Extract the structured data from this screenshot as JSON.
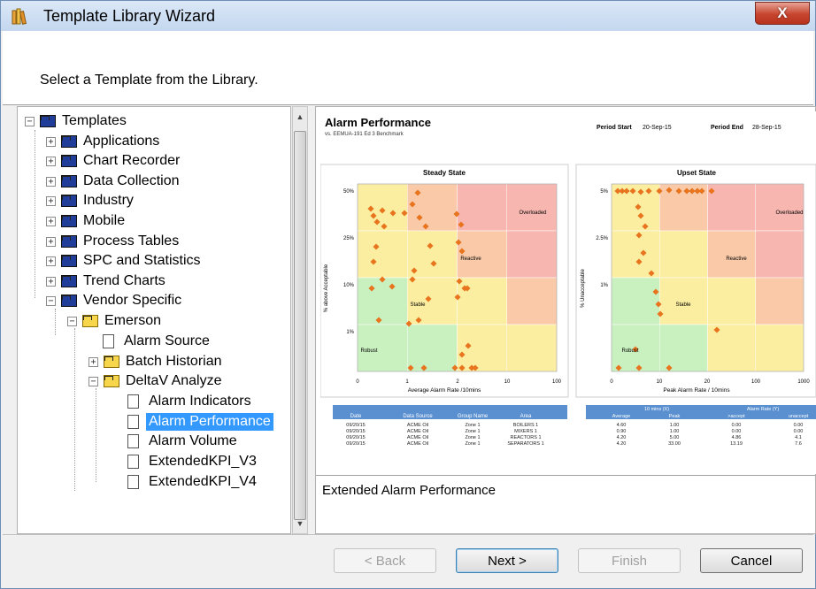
{
  "window": {
    "title": "Template Library Wizard",
    "close_glyph": "X"
  },
  "header": {
    "instruction": "Select a Template from the Library."
  },
  "tree": {
    "root": "Templates",
    "items": [
      "Applications",
      "Chart Recorder",
      "Data Collection",
      "Industry",
      "Mobile",
      "Process Tables",
      "SPC and Statistics",
      "Trend Charts",
      "Vendor Specific"
    ],
    "vendor": "Emerson",
    "emerson_children": {
      "alarm_source": "Alarm Source",
      "batch_historian": "Batch Historian",
      "deltav": "DeltaV Analyze"
    },
    "deltav_children": [
      "Alarm Indicators",
      "Alarm Performance",
      "Alarm Volume",
      "ExtendedKPI_V3",
      "ExtendedKPI_V4"
    ],
    "selected": "Alarm Performance"
  },
  "preview": {
    "title": "Alarm Performance",
    "subtitle": "vs. EEMUA-191 Ed 3 Benchmark",
    "period_start_label": "Period Start",
    "period_start": "20-Sep-15",
    "period_end_label": "Period End",
    "period_end": "28-Sep-15",
    "left_chart": {
      "title": "Steady State",
      "ylabel": "% above Acceptable",
      "xlabel": "Average Alarm Rate /10mins",
      "yticks": [
        "50%",
        "25%",
        "10%",
        "1%"
      ],
      "xticks": [
        "0",
        "1",
        "2",
        "10",
        "100"
      ],
      "zones": [
        "Overloaded",
        "Reactive",
        "Stable",
        "Robust"
      ]
    },
    "right_chart": {
      "title": "Upset State",
      "ylabel": "% Unacceptable",
      "xlabel": "Peak Alarm Rate / 10mins",
      "yticks": [
        "5%",
        "2.5%",
        "1%"
      ],
      "xticks": [
        "0",
        "10",
        "20",
        "100",
        "1000"
      ],
      "zones": [
        "Overloaded",
        "Reactive",
        "Stable",
        "Robust"
      ]
    },
    "left_table": {
      "headers": [
        "Date",
        "Data Source",
        "Group Name",
        "Area"
      ],
      "rows": [
        [
          "09/20/15",
          "ACME Oil",
          "Zone 1",
          "BOILERS 1"
        ],
        [
          "09/20/15",
          "ACME Oil",
          "Zone 1",
          "MIXERS 1"
        ],
        [
          "09/20/15",
          "ACME Oil",
          "Zone 1",
          "REACTORS 1"
        ],
        [
          "09/20/15",
          "ACME Oil",
          "Zone 1",
          "SEPARATORS 1"
        ]
      ]
    },
    "right_table": {
      "group_headers": [
        "10 mins (X)",
        "Alarm Rate (Y)"
      ],
      "headers": [
        "Average",
        "Peak",
        ">accept",
        "unaccept"
      ],
      "rows": [
        [
          "4.60",
          "1.00",
          "0.00",
          "0.00"
        ],
        [
          "0.90",
          "1.00",
          "0.00",
          "0.00"
        ],
        [
          "4.20",
          "5.00",
          "4.86",
          "4.1"
        ],
        [
          "4.20",
          "33.00",
          "13.19",
          "7.6"
        ]
      ]
    },
    "description": "Extended Alarm Performance"
  },
  "buttons": {
    "back": "< Back",
    "next": "Next >",
    "finish": "Finish",
    "cancel": "Cancel"
  }
}
